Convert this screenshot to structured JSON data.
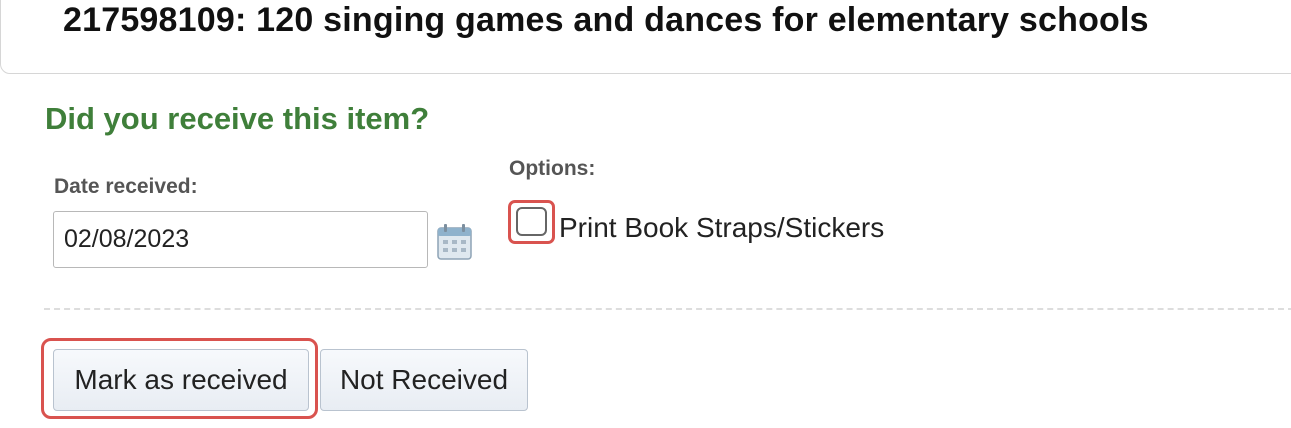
{
  "item": {
    "title": "217598109: 120 singing games and dances for elementary schools"
  },
  "receive_form": {
    "question": "Did you receive this item?",
    "date_label": "Date received:",
    "date_value": "02/08/2023",
    "options_label": "Options:",
    "print_option_label": "Print Book Straps/Stickers",
    "print_option_checked": false,
    "calendar_icon": "calendar-icon"
  },
  "actions": {
    "mark_received_label": "Mark as received",
    "not_received_label": "Not Received"
  },
  "colors": {
    "question_text": "#3f7f3a",
    "highlight_border": "#d9534f",
    "button_border": "#b9c3cf"
  }
}
